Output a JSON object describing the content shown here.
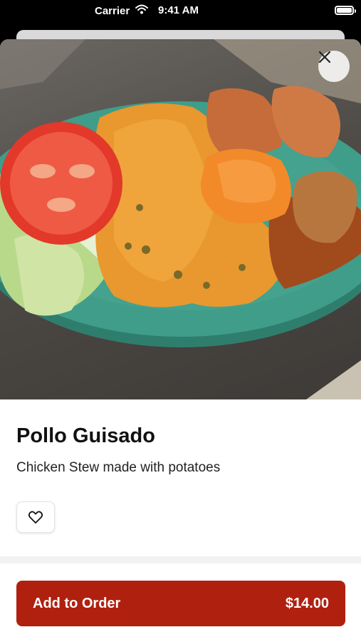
{
  "status_bar": {
    "carrier": "Carrier",
    "time": "9:41 AM"
  },
  "item": {
    "name": "Pollo Guisado",
    "description": "Chicken Stew made with potatoes",
    "image_alt": "Plate of chicken stew with potatoes, yellow rice, lettuce and tomato"
  },
  "actions": {
    "add_to_order_label": "Add to Order",
    "price": "$14.00"
  },
  "icons": {
    "close": "close-icon",
    "favorite": "heart-icon",
    "wifi": "wifi-icon",
    "battery": "battery-icon"
  },
  "colors": {
    "primary_button": "#b0200f",
    "plate": "#3f9d89"
  }
}
